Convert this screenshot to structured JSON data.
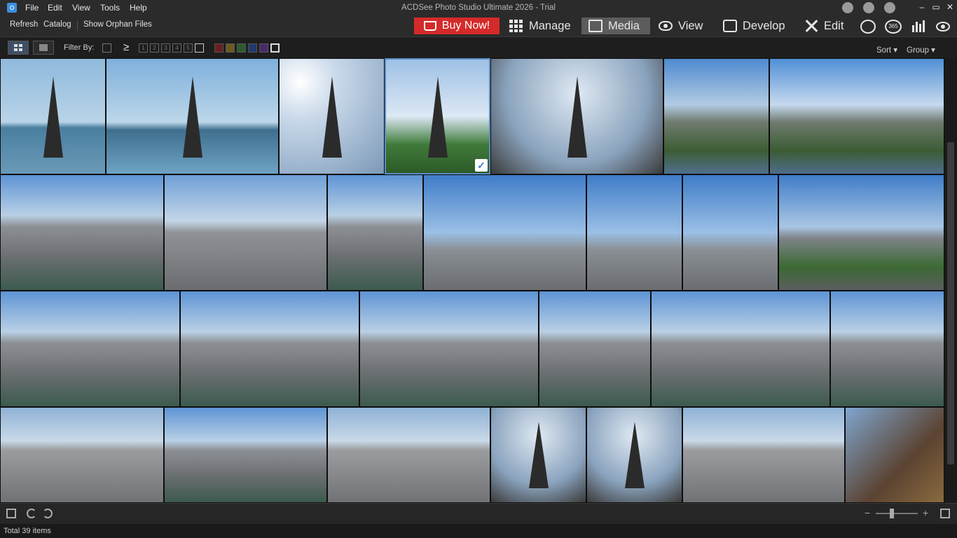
{
  "window": {
    "title": "ACDSee Photo Studio Ultimate 2026 - Trial",
    "menus": [
      "File",
      "Edit",
      "View",
      "Tools",
      "Help"
    ],
    "controls": {
      "minimize": "–",
      "maximize": "▭",
      "close": "✕"
    }
  },
  "subbar": {
    "links": [
      "Refresh",
      "Catalog",
      "Show Orphan Files"
    ],
    "buy_label": "Buy Now!",
    "modes": [
      {
        "label": "Manage",
        "icon": "grid-icon"
      },
      {
        "label": "Media",
        "icon": "media-icon",
        "active": true
      },
      {
        "label": "View",
        "icon": "eye-icon"
      },
      {
        "label": "Develop",
        "icon": "develop-icon"
      },
      {
        "label": "Edit",
        "icon": "edit-icon"
      }
    ],
    "extra_icons": [
      "people-icon",
      "360-icon",
      "dashboard-icon",
      "online-icon"
    ],
    "badge_360": "365"
  },
  "toolbar": {
    "filter_label": "Filter By:",
    "ge_symbol": "≥",
    "rating_boxes": [
      "1",
      "2",
      "3",
      "4",
      "5"
    ],
    "color_labels": [
      "#6b2020",
      "#6b5a20",
      "#2f5a2f",
      "#203a6b",
      "#4a2a6b"
    ],
    "sort_label": "Sort ▾",
    "group_label": "Group ▾"
  },
  "gallery": {
    "selected_index": 3,
    "thumbnails": [
      {
        "kind": "tower-river"
      },
      {
        "kind": "tower-river-wide"
      },
      {
        "kind": "tower-clouds"
      },
      {
        "kind": "tower-trees"
      },
      {
        "kind": "tower-under"
      },
      {
        "kind": "trocadero"
      },
      {
        "kind": "trocadero-wide"
      },
      {
        "kind": "city-river"
      },
      {
        "kind": "city"
      },
      {
        "kind": "city-river"
      },
      {
        "kind": "city-sky"
      },
      {
        "kind": "city-sky"
      },
      {
        "kind": "city-sky"
      },
      {
        "kind": "champ-de-mars"
      },
      {
        "kind": "city-river"
      },
      {
        "kind": "city-river"
      },
      {
        "kind": "city-river"
      },
      {
        "kind": "city-river"
      },
      {
        "kind": "city-river"
      },
      {
        "kind": "city-river"
      },
      {
        "kind": "city-haze"
      },
      {
        "kind": "city-river"
      },
      {
        "kind": "city-haze"
      },
      {
        "kind": "tower-under"
      },
      {
        "kind": "tower-under"
      },
      {
        "kind": "city-haze"
      },
      {
        "kind": "tower-structure"
      }
    ]
  },
  "footer": {
    "zoom_minus": "−",
    "zoom_plus": "+"
  },
  "status": {
    "text": "Total 39 items"
  }
}
